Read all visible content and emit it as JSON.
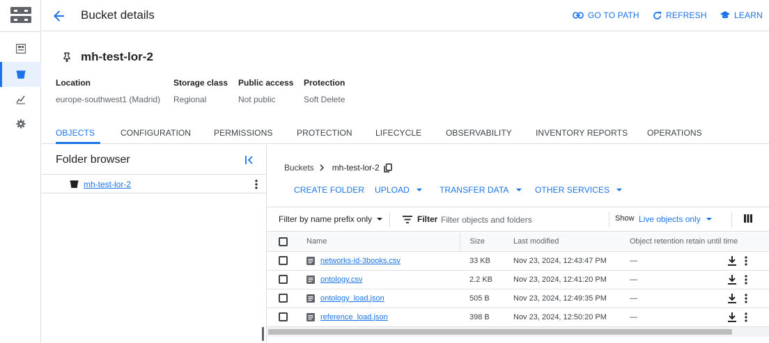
{
  "header": {
    "title": "Bucket details",
    "actions": [
      {
        "label": "GO TO PATH",
        "icon": "link-icon"
      },
      {
        "label": "REFRESH",
        "icon": "refresh-icon"
      },
      {
        "label": "LEARN",
        "icon": "school-icon"
      }
    ]
  },
  "rail": {
    "items": [
      {
        "icon": "dashboard-icon"
      },
      {
        "icon": "bucket-icon",
        "active": true
      },
      {
        "icon": "monitoring-icon"
      },
      {
        "icon": "settings-icon"
      }
    ]
  },
  "bucket": {
    "name": "mh-test-lor-2",
    "info": [
      {
        "label": "Location",
        "value": "europe-southwest1 (Madrid)"
      },
      {
        "label": "Storage class",
        "value": "Regional"
      },
      {
        "label": "Public access",
        "value": "Not public"
      },
      {
        "label": "Protection",
        "value": "Soft Delete"
      }
    ]
  },
  "tabs": [
    {
      "label": "OBJECTS",
      "active": true
    },
    {
      "label": "CONFIGURATION"
    },
    {
      "label": "PERMISSIONS"
    },
    {
      "label": "PROTECTION"
    },
    {
      "label": "LIFECYCLE"
    },
    {
      "label": "OBSERVABILITY"
    },
    {
      "label": "INVENTORY REPORTS"
    },
    {
      "label": "OPERATIONS"
    }
  ],
  "folder_browser": {
    "title": "Folder browser",
    "items": [
      {
        "label": "mh-test-lor-2"
      }
    ]
  },
  "breadcrumb": {
    "root": "Buckets",
    "current": "mh-test-lor-2"
  },
  "actions": [
    {
      "label": "CREATE FOLDER",
      "dropdown": false
    },
    {
      "label": "UPLOAD",
      "dropdown": true
    },
    {
      "label": "TRANSFER DATA",
      "dropdown": true
    },
    {
      "label": "OTHER SERVICES",
      "dropdown": true
    }
  ],
  "filter": {
    "prefix_label": "Filter by name prefix only",
    "filter_label": "Filter",
    "placeholder": "Filter objects and folders",
    "show_label": "Show",
    "show_value": "Live objects only"
  },
  "table": {
    "columns": [
      "Name",
      "Size",
      "Last modified",
      "Object retention retain until time"
    ],
    "rows": [
      {
        "name": "networks-id-3books.csv",
        "size": "33 KB",
        "modified": "Nov 23, 2024, 12:43:47 PM",
        "retention": "—"
      },
      {
        "name": "ontology.csv",
        "size": "2.2 KB",
        "modified": "Nov 23, 2024, 12:41:20 PM",
        "retention": "—"
      },
      {
        "name": "ontology_load.json",
        "size": "505 B",
        "modified": "Nov 23, 2024, 12:49:35 PM",
        "retention": "—"
      },
      {
        "name": "reference_load.json",
        "size": "398 B",
        "modified": "Nov 23, 2024, 12:50:20 PM",
        "retention": "—"
      }
    ]
  },
  "colors": {
    "accent": "#1a73e8",
    "text": "#202124",
    "muted": "#5f6368",
    "border": "#dadce0",
    "active_bg": "#e8f0fe"
  }
}
